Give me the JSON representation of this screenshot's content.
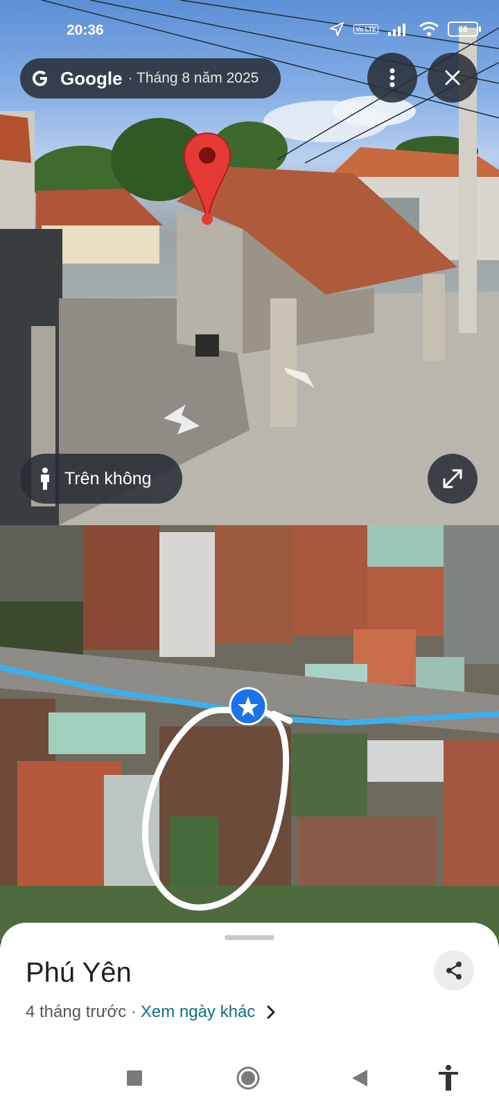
{
  "status_bar": {
    "time": "20:36",
    "volte": "Vo LTE",
    "battery": "68"
  },
  "header": {
    "brand": "Google",
    "date": "· Tháng 8 năm 2025"
  },
  "controls": {
    "aerial_label": "Trên không"
  },
  "sheet": {
    "title": "Phú Yên",
    "when": "4 tháng trước ·",
    "other_dates_link": "Xem ngày khác"
  },
  "colors": {
    "accent_blue": "#1a73e8",
    "route_cyan": "#29b6f6",
    "pin_red": "#e53935",
    "link_teal": "#0b6f87"
  },
  "icons": [
    "google-g-icon",
    "more-vert-icon",
    "close-icon",
    "person-icon",
    "expand-icon",
    "share-icon",
    "location-arrow-icon",
    "wifi-icon",
    "signal-icon"
  ]
}
